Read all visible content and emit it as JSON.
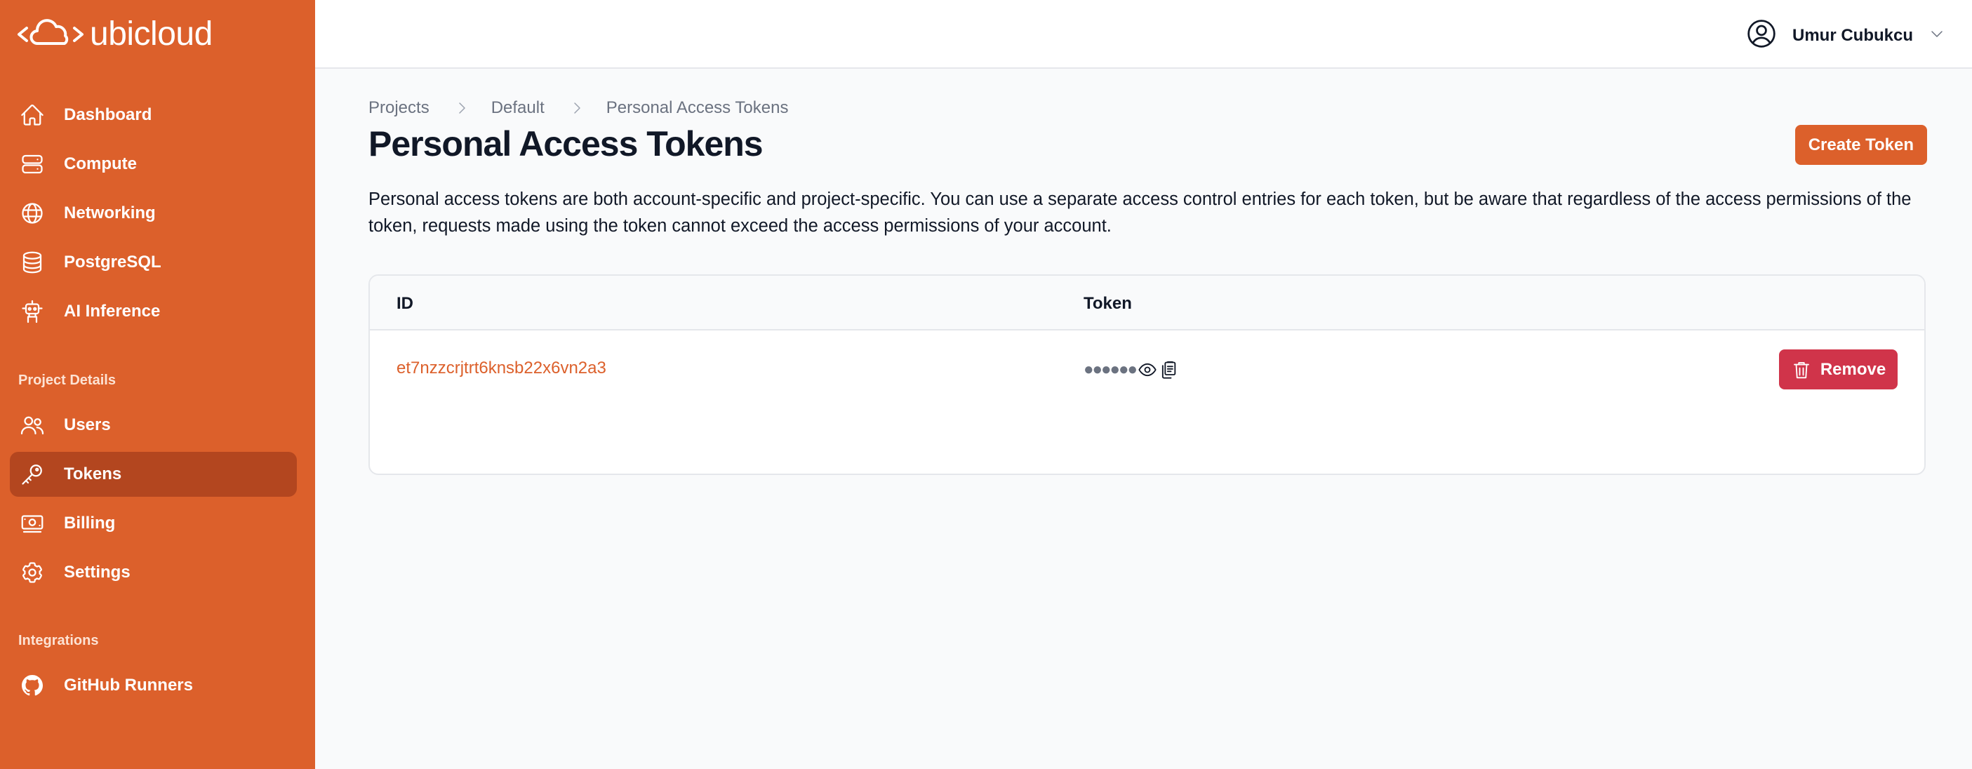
{
  "brand": {
    "name": "ubicloud",
    "color": "#dc602b"
  },
  "sidebar": {
    "main_items": [
      {
        "label": "Dashboard",
        "icon": "home-icon"
      },
      {
        "label": "Compute",
        "icon": "server-icon"
      },
      {
        "label": "Networking",
        "icon": "globe-icon"
      },
      {
        "label": "PostgreSQL",
        "icon": "database-icon"
      },
      {
        "label": "AI Inference",
        "icon": "robot-icon"
      }
    ],
    "project_section_title": "Project Details",
    "project_items": [
      {
        "label": "Users",
        "icon": "users-icon"
      },
      {
        "label": "Tokens",
        "icon": "key-icon",
        "active": true
      },
      {
        "label": "Billing",
        "icon": "banknotes-icon"
      },
      {
        "label": "Settings",
        "icon": "gear-icon"
      }
    ],
    "integrations_title": "Integrations",
    "integration_items": [
      {
        "label": "GitHub Runners",
        "icon": "github-icon"
      }
    ]
  },
  "header": {
    "user_name": "Umur Cubukcu"
  },
  "breadcrumb": [
    "Projects",
    "Default",
    "Personal Access Tokens"
  ],
  "page": {
    "title": "Personal Access Tokens",
    "create_button": "Create Token",
    "description": "Personal access tokens are both account-specific and project-specific. You can use a separate access control entries for each token, but be aware that regardless of the access permissions of the token, requests made using the token cannot exceed the access permissions of your account."
  },
  "table": {
    "columns": [
      "ID",
      "Token"
    ],
    "rows": [
      {
        "id": "et7nzzcrjtrt6knsb22x6vn2a3",
        "token_masked": "●●●●●●",
        "action": "Remove"
      }
    ]
  },
  "colors": {
    "danger": "#d0344a",
    "sidebar_active": "#b3461f"
  }
}
